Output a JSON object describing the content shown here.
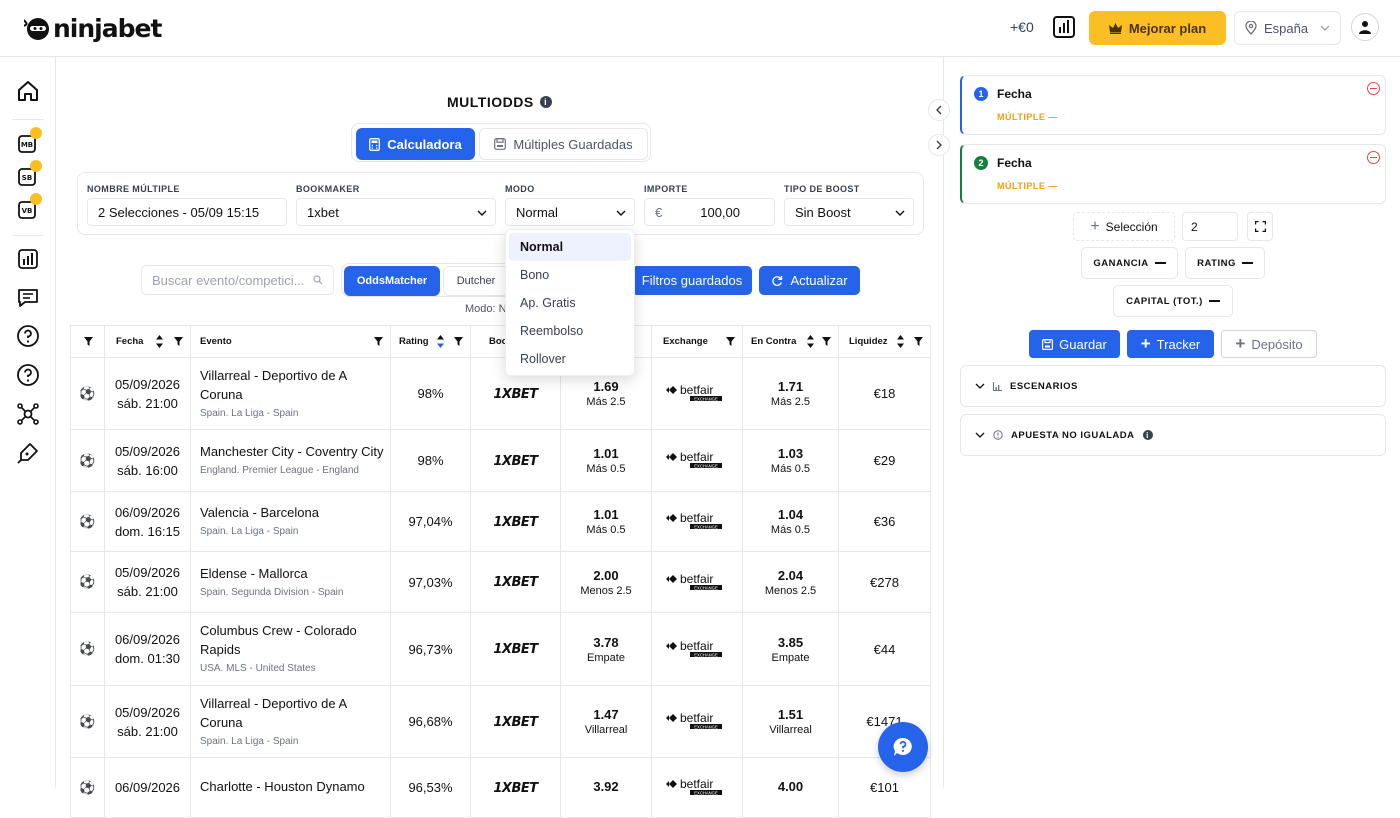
{
  "header": {
    "logo": "ninjabet",
    "balance": "+€0",
    "upgrade_label": "Mejorar plan",
    "country": "España",
    "colors": {
      "accent": "#2563eb",
      "upgrade": "#fbbf24"
    }
  },
  "sidebar": {
    "items": [
      {
        "icon": "home-icon"
      },
      {
        "icon": "mb-icon",
        "badge": "MB"
      },
      {
        "icon": "sb-icon",
        "badge": "SB"
      },
      {
        "icon": "vb-icon",
        "badge": "VB"
      },
      {
        "icon": "bar-chart-icon"
      },
      {
        "icon": "chat-icon"
      },
      {
        "icon": "help-icon"
      },
      {
        "icon": "help-icon"
      },
      {
        "icon": "network-icon"
      },
      {
        "icon": "pen-icon"
      }
    ]
  },
  "main": {
    "title": "MULTIODDS",
    "tabs": [
      {
        "label": "Calculadora",
        "active": true
      },
      {
        "label": "Múltiples Guardadas",
        "active": false
      }
    ],
    "form": {
      "nombre_label": "NOMBRE MÚLTIPLE",
      "nombre_value": "2 Selecciones - 05/09 15:15",
      "bookmaker_label": "BOOKMAKER",
      "bookmaker_value": "1xbet",
      "modo_label": "MODO",
      "modo_value": "Normal",
      "importe_label": "IMPORTE",
      "importe_currency": "€",
      "importe_value": "100,00",
      "boost_label": "TIPO DE BOOST",
      "boost_value": "Sin Boost"
    },
    "modo_options": [
      "Normal",
      "Bono",
      "Ap. Gratis",
      "Reembolso",
      "Rollover"
    ],
    "search_placeholder": "Buscar evento/competici...",
    "segments": [
      "OddsMatcher",
      "Dutcher"
    ],
    "saved_filters_label": "Filtros guardados",
    "refresh_label": "Actualizar",
    "modo_text": "Modo: N",
    "table": {
      "headers": {
        "fecha": "Fecha",
        "evento": "Evento",
        "rating": "Rating",
        "bookmaker": "Boo",
        "exchange": "Exchange",
        "en_contra": "En Contra",
        "liquidez": "Liquidez"
      },
      "rows": [
        {
          "date": "05/09/2026",
          "time": "sáb. 21:00",
          "event": "Villarreal - Deportivo de A Coruna",
          "league": "Spain. La Liga - Spain",
          "rating": "98%",
          "bookmaker": "1XBET",
          "odd": "1.69",
          "market": "Más 2.5",
          "exchange": "betfair",
          "lay": "1.71",
          "lay_market": "Más 2.5",
          "liquidity": "€18"
        },
        {
          "date": "05/09/2026",
          "time": "sáb. 16:00",
          "event": "Manchester City - Coventry City",
          "league": "England. Premier League - England",
          "rating": "98%",
          "bookmaker": "1XBET",
          "odd": "1.01",
          "market": "Más 0.5",
          "exchange": "betfair",
          "lay": "1.03",
          "lay_market": "Más 0.5",
          "liquidity": "€29"
        },
        {
          "date": "06/09/2026",
          "time": "dom. 16:15",
          "event": "Valencia - Barcelona",
          "league": "Spain. La Liga - Spain",
          "rating": "97,04%",
          "bookmaker": "1XBET",
          "odd": "1.01",
          "market": "Más 0.5",
          "exchange": "betfair",
          "lay": "1.04",
          "lay_market": "Más 0.5",
          "liquidity": "€36"
        },
        {
          "date": "05/09/2026",
          "time": "sáb. 21:00",
          "event": "Eldense - Mallorca",
          "league": "Spain. Segunda Division - Spain",
          "rating": "97,03%",
          "bookmaker": "1XBET",
          "odd": "2.00",
          "market": "Menos 2.5",
          "exchange": "betfair",
          "lay": "2.04",
          "lay_market": "Menos 2.5",
          "liquidity": "€278"
        },
        {
          "date": "06/09/2026",
          "time": "dom. 01:30",
          "event": "Columbus Crew - Colorado Rapids",
          "league": "USA. MLS - United States",
          "rating": "96,73%",
          "bookmaker": "1XBET",
          "odd": "3.78",
          "market": "Empate",
          "exchange": "betfair",
          "lay": "3.85",
          "lay_market": "Empate",
          "liquidity": "€44"
        },
        {
          "date": "05/09/2026",
          "time": "sáb. 21:00",
          "event": "Villarreal - Deportivo de A Coruna",
          "league": "Spain. La Liga - Spain",
          "rating": "96,68%",
          "bookmaker": "1XBET",
          "odd": "1.47",
          "market": "Villarreal",
          "exchange": "betfair",
          "lay": "1.51",
          "lay_market": "Villarreal",
          "liquidity": "€1471"
        },
        {
          "date": "06/09/2026",
          "time": "",
          "event": "Charlotte - Houston Dynamo",
          "league": "",
          "rating": "96,53%",
          "bookmaker": "1XBET",
          "odd": "3.92",
          "market": "",
          "exchange": "betfair",
          "lay": "4.00",
          "lay_market": "",
          "liquidity": "€101"
        }
      ]
    }
  },
  "panel": {
    "selections": [
      {
        "num": "1",
        "title": "Fecha",
        "sub": "MÚLTIPLE —",
        "color": "#2563eb"
      },
      {
        "num": "2",
        "title": "Fecha",
        "sub": "MÚLTIPLE —",
        "color": "#15803d"
      }
    ],
    "add_selection_label": "Selección",
    "selection_count": "2",
    "ganancia_label": "GANANCIA",
    "rating_label": "RATING",
    "capital_label": "CAPITAL (TOT.)",
    "guardar_label": "Guardar",
    "tracker_label": "Tracker",
    "deposito_label": "Depósito",
    "escenarios_label": "ESCENARIOS",
    "apuesta_label": "APUESTA NO IGUALADA"
  }
}
